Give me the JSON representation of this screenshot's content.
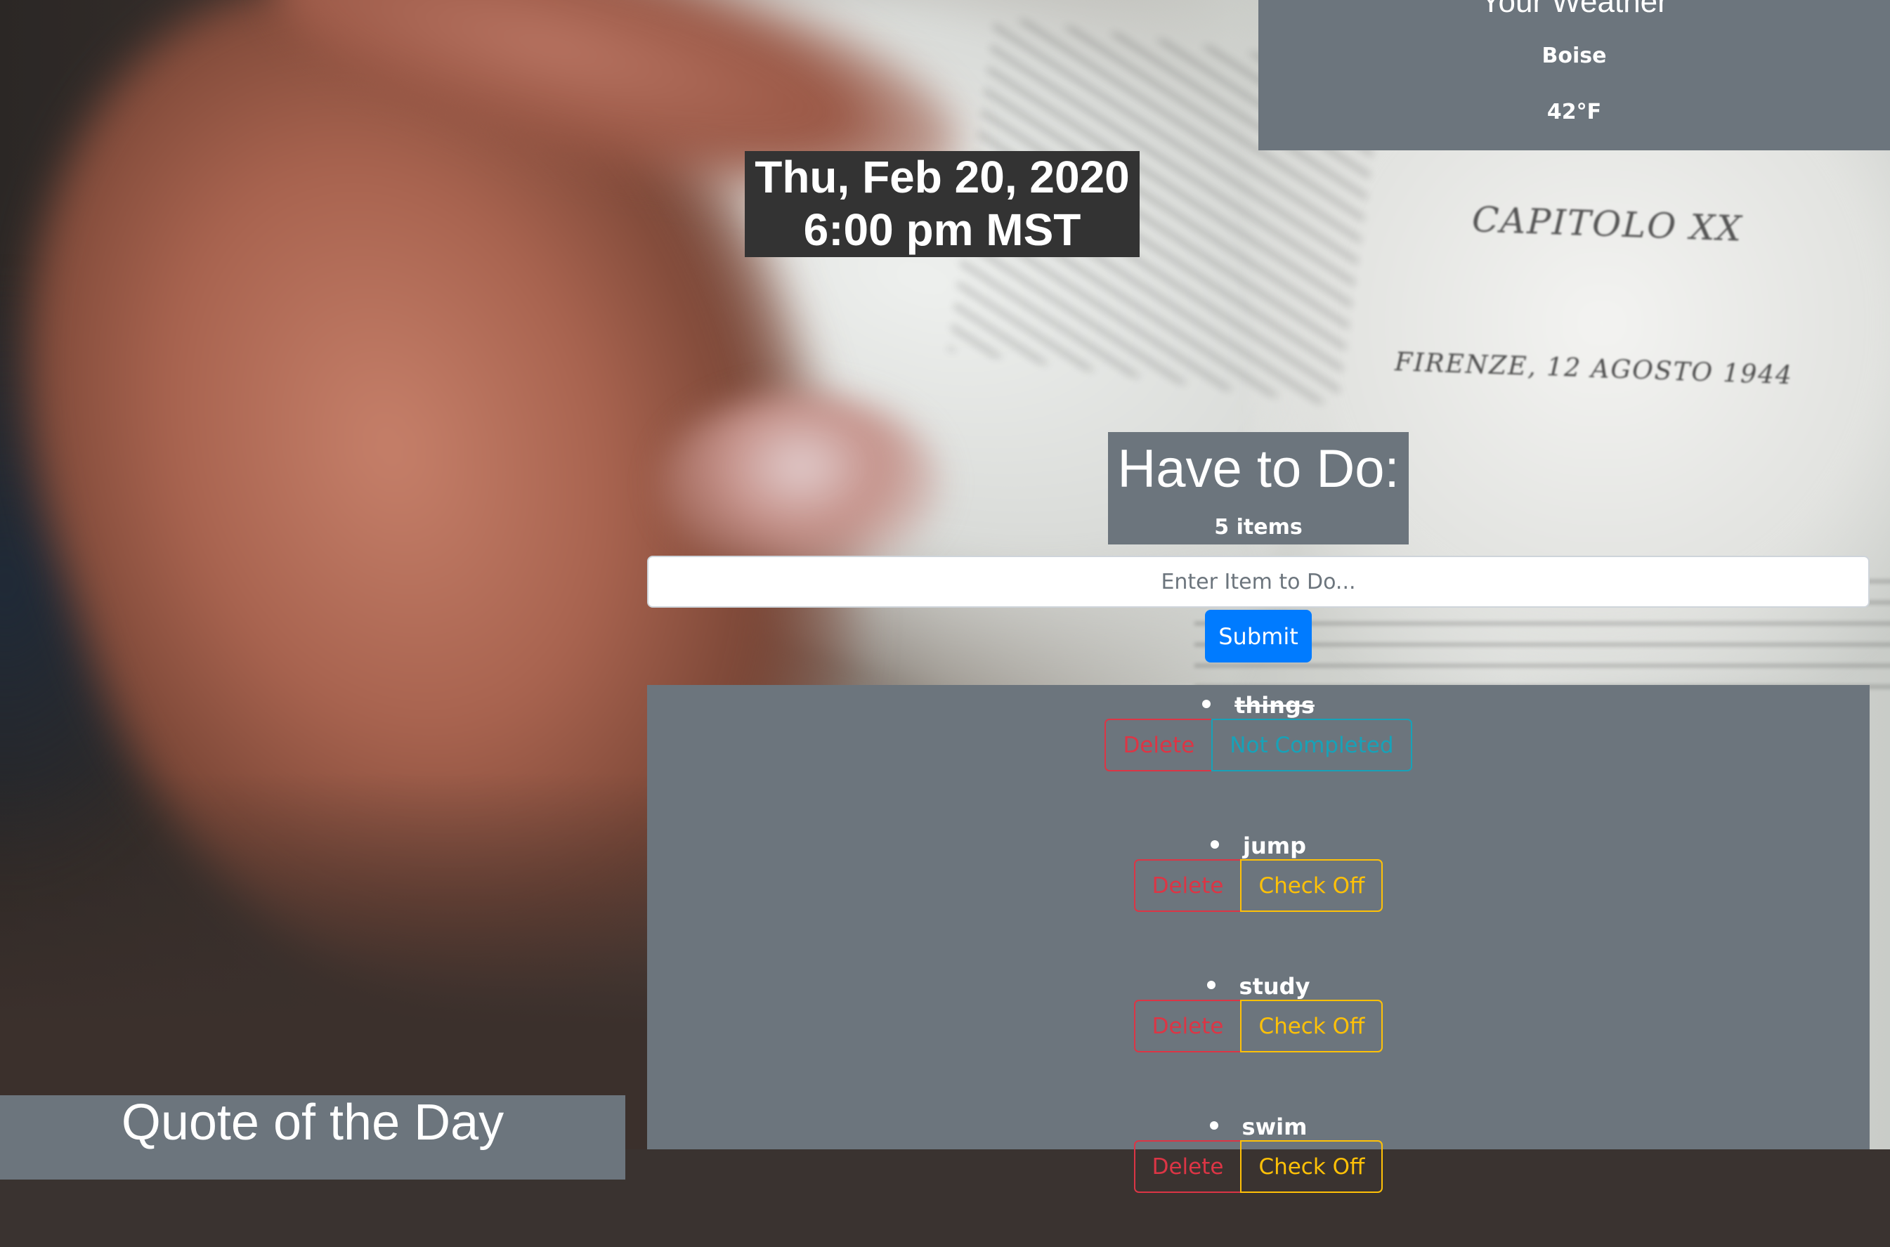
{
  "weather": {
    "title": "Your Weather",
    "city": "Boise",
    "temperature": "42°F"
  },
  "clock": {
    "date": "Thu, Feb 20, 2020",
    "time": "6:00 pm MST"
  },
  "todo": {
    "title": "Have to Do:",
    "count": "5 items",
    "input_placeholder": "Enter Item to Do...",
    "submit_label": "Submit",
    "items": [
      {
        "label": "things",
        "completed": true,
        "delete_label": "Delete",
        "toggle_label": "Not Completed"
      },
      {
        "label": "jump",
        "completed": false,
        "delete_label": "Delete",
        "toggle_label": "Check Off"
      },
      {
        "label": "study",
        "completed": false,
        "delete_label": "Delete",
        "toggle_label": "Check Off"
      },
      {
        "label": "swim",
        "completed": false,
        "delete_label": "Delete",
        "toggle_label": "Check Off"
      }
    ]
  },
  "quote": {
    "title": "Quote of the Day"
  },
  "background": {
    "book_heading": "CAPITOLO XX",
    "book_subheading": "FIRENZE, 12 AGOSTO 1944"
  },
  "colors": {
    "panel": "#6c757d",
    "clock_bg": "#333333",
    "primary": "#007bff",
    "danger": "#dc3545",
    "warning": "#ffc107",
    "info": "#17a2b8"
  }
}
